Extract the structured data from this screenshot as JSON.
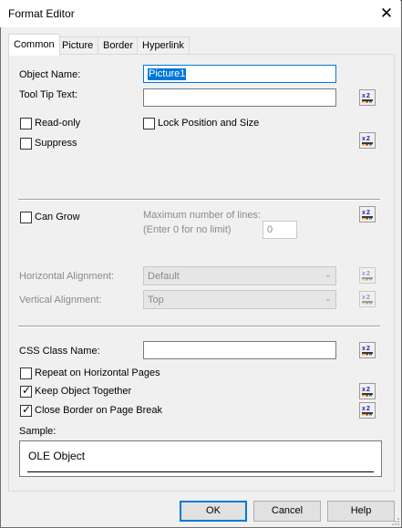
{
  "window": {
    "title": "Format Editor",
    "close_glyph": "✕"
  },
  "tabs": [
    {
      "label": "Common",
      "active": true
    },
    {
      "label": "Picture",
      "active": false
    },
    {
      "label": "Border",
      "active": false
    },
    {
      "label": "Hyperlink",
      "active": false
    }
  ],
  "common": {
    "object_name_label": "Object Name:",
    "object_name_value": "Picture1",
    "tooltip_label": "Tool Tip Text:",
    "tooltip_value": "",
    "read_only_label": "Read-only",
    "read_only_checked": false,
    "lock_label": "Lock Position and Size",
    "lock_checked": false,
    "suppress_label": "Suppress",
    "suppress_checked": false,
    "can_grow_label": "Can Grow",
    "can_grow_checked": false,
    "max_lines_label": "Maximum number of lines:",
    "max_lines_hint": "(Enter 0 for no limit)",
    "max_lines_value": "0",
    "h_align_label": "Horizontal Alignment:",
    "h_align_value": "Default",
    "v_align_label": "Vertical Alignment:",
    "v_align_value": "Top",
    "css_label": "CSS Class Name:",
    "css_value": "",
    "repeat_label": "Repeat on Horizontal Pages",
    "repeat_checked": false,
    "keep_label": "Keep Object Together",
    "keep_checked": true,
    "close_border_label": "Close Border on Page Break",
    "close_border_checked": true,
    "sample_label": "Sample:",
    "sample_text": "OLE Object"
  },
  "buttons": {
    "ok": "OK",
    "cancel": "Cancel",
    "help": "Help"
  },
  "icons": {
    "formula": "formula-x2-icon",
    "check": "✓",
    "dropdown": "⌄"
  },
  "colors": {
    "accent": "#0078d7",
    "disabled_text": "#8a8a8a"
  }
}
